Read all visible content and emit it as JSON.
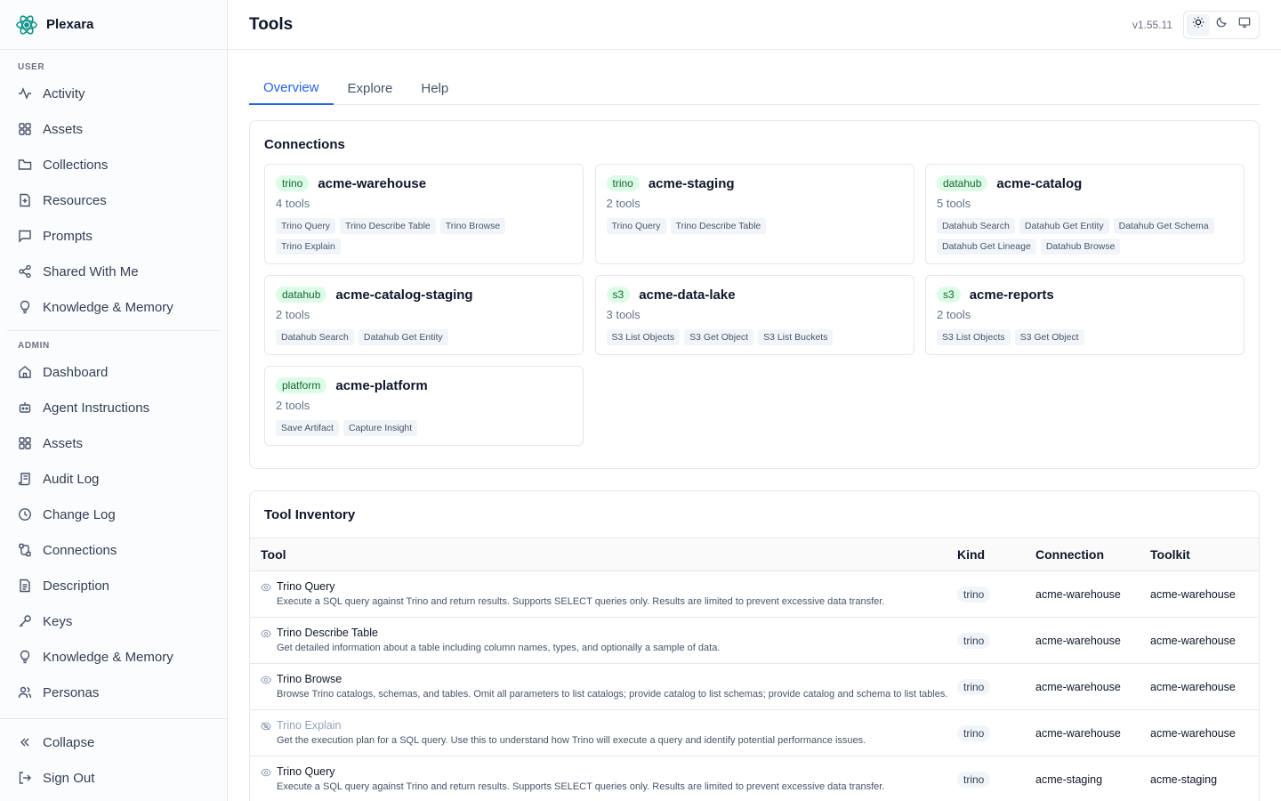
{
  "brand": {
    "name": "Plexara"
  },
  "sidebar": {
    "user_label": "USER",
    "user_items": [
      {
        "label": "Activity",
        "icon": "activity-icon"
      },
      {
        "label": "Assets",
        "icon": "grid-icon"
      },
      {
        "label": "Collections",
        "icon": "folder-icon"
      },
      {
        "label": "Resources",
        "icon": "file-icon"
      },
      {
        "label": "Prompts",
        "icon": "message-icon"
      },
      {
        "label": "Shared With Me",
        "icon": "share-icon"
      },
      {
        "label": "Knowledge & Memory",
        "icon": "lightbulb-icon"
      }
    ],
    "admin_label": "ADMIN",
    "admin_items": [
      {
        "label": "Dashboard",
        "icon": "home-icon"
      },
      {
        "label": "Agent Instructions",
        "icon": "bot-icon"
      },
      {
        "label": "Assets",
        "icon": "grid-icon"
      },
      {
        "label": "Audit Log",
        "icon": "scroll-icon"
      },
      {
        "label": "Change Log",
        "icon": "clock-icon"
      },
      {
        "label": "Connections",
        "icon": "cable-icon"
      },
      {
        "label": "Description",
        "icon": "document-icon"
      },
      {
        "label": "Keys",
        "icon": "key-icon"
      },
      {
        "label": "Knowledge & Memory",
        "icon": "lightbulb-icon"
      },
      {
        "label": "Personas",
        "icon": "users-icon"
      }
    ],
    "collapse_label": "Collapse",
    "signout_label": "Sign Out"
  },
  "header": {
    "title": "Tools",
    "version": "v1.55.11"
  },
  "tabs": [
    "Overview",
    "Explore",
    "Help"
  ],
  "connections": {
    "title": "Connections",
    "items": [
      {
        "kind": "trino",
        "name": "acme-warehouse",
        "count": "4 tools",
        "tools": [
          "Trino Query",
          "Trino Describe Table",
          "Trino Browse",
          "Trino Explain"
        ]
      },
      {
        "kind": "trino",
        "name": "acme-staging",
        "count": "2 tools",
        "tools": [
          "Trino Query",
          "Trino Describe Table"
        ]
      },
      {
        "kind": "datahub",
        "name": "acme-catalog",
        "count": "5 tools",
        "tools": [
          "Datahub Search",
          "Datahub Get Entity",
          "Datahub Get Schema",
          "Datahub Get Lineage",
          "Datahub Browse"
        ]
      },
      {
        "kind": "datahub",
        "name": "acme-catalog-staging",
        "count": "2 tools",
        "tools": [
          "Datahub Search",
          "Datahub Get Entity"
        ]
      },
      {
        "kind": "s3",
        "name": "acme-data-lake",
        "count": "3 tools",
        "tools": [
          "S3 List Objects",
          "S3 Get Object",
          "S3 List Buckets"
        ]
      },
      {
        "kind": "s3",
        "name": "acme-reports",
        "count": "2 tools",
        "tools": [
          "S3 List Objects",
          "S3 Get Object"
        ]
      },
      {
        "kind": "platform",
        "name": "acme-platform",
        "count": "2 tools",
        "tools": [
          "Save Artifact",
          "Capture Insight"
        ]
      }
    ]
  },
  "inventory": {
    "title": "Tool Inventory",
    "headers": {
      "tool": "Tool",
      "kind": "Kind",
      "connection": "Connection",
      "toolkit": "Toolkit"
    },
    "rows": [
      {
        "name": "Trino Query",
        "desc": "Execute a SQL query against Trino and return results. Supports SELECT queries only. Results are limited to prevent excessive data transfer.",
        "kind": "trino",
        "connection": "acme-warehouse",
        "toolkit": "acme-warehouse",
        "hidden": false
      },
      {
        "name": "Trino Describe Table",
        "desc": "Get detailed information about a table including column names, types, and optionally a sample of data.",
        "kind": "trino",
        "connection": "acme-warehouse",
        "toolkit": "acme-warehouse",
        "hidden": false
      },
      {
        "name": "Trino Browse",
        "desc": "Browse Trino catalogs, schemas, and tables. Omit all parameters to list catalogs; provide catalog to list schemas; provide catalog and schema to list tables.",
        "kind": "trino",
        "connection": "acme-warehouse",
        "toolkit": "acme-warehouse",
        "hidden": false
      },
      {
        "name": "Trino Explain",
        "desc": "Get the execution plan for a SQL query. Use this to understand how Trino will execute a query and identify potential performance issues.",
        "kind": "trino",
        "connection": "acme-warehouse",
        "toolkit": "acme-warehouse",
        "hidden": true
      },
      {
        "name": "Trino Query",
        "desc": "Execute a SQL query against Trino and return results. Supports SELECT queries only. Results are limited to prevent excessive data transfer.",
        "kind": "trino",
        "connection": "acme-staging",
        "toolkit": "acme-staging",
        "hidden": false
      }
    ]
  }
}
